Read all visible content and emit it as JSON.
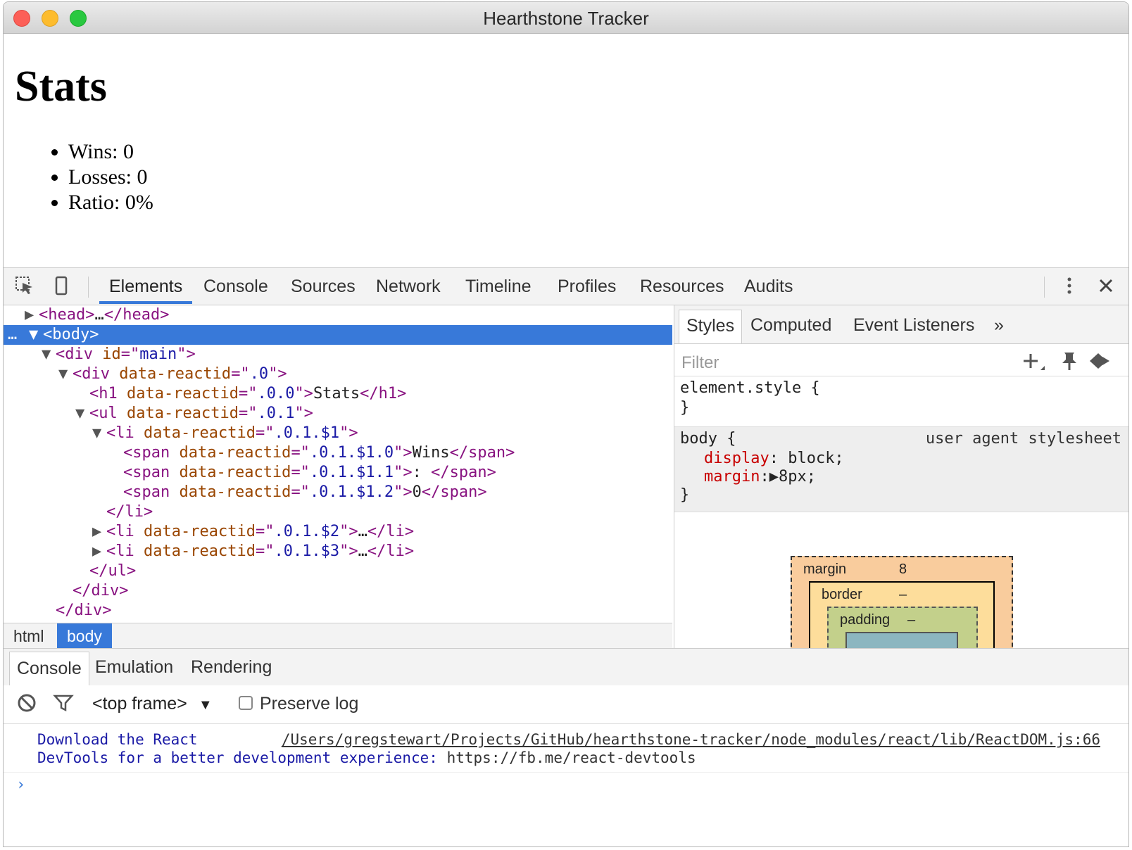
{
  "window": {
    "title": "Hearthstone Tracker"
  },
  "page": {
    "heading": "Stats",
    "items": [
      "Wins: 0",
      "Losses: 0",
      "Ratio: 0%"
    ]
  },
  "devtools": {
    "tabs": [
      "Elements",
      "Console",
      "Sources",
      "Network",
      "Timeline",
      "Profiles",
      "Resources",
      "Audits"
    ],
    "active_tab": "Elements",
    "dom": {
      "r0": {
        "open": "<head>",
        "ellipsis": "…",
        "close": "</head>"
      },
      "r1": {
        "dots": "…",
        "tag": "<body>"
      },
      "r2": {
        "tag_open": "<div",
        "attr": "id",
        "eq": "=\"",
        "val": "main",
        "end": "\">"
      },
      "r3": {
        "tag_open": "<div",
        "attr": "data-reactid",
        "eq": "=\"",
        "val": ".0",
        "end": "\">"
      },
      "r4": {
        "tag_open": "<h1",
        "attr": "data-reactid",
        "eq": "=\"",
        "val": ".0.0",
        "end": "\">",
        "text": "Stats",
        "close": "</h1>"
      },
      "r5": {
        "tag_open": "<ul",
        "attr": "data-reactid",
        "eq": "=\"",
        "val": ".0.1",
        "end": "\">"
      },
      "r6": {
        "tag_open": "<li",
        "attr": "data-reactid",
        "eq": "=\"",
        "val": ".0.1.$1",
        "end": "\">"
      },
      "r7": {
        "tag_open": "<span",
        "attr": "data-reactid",
        "eq": "=\"",
        "val": ".0.1.$1.0",
        "end": "\">",
        "text": "Wins",
        "close": "</span>"
      },
      "r8": {
        "tag_open": "<span",
        "attr": "data-reactid",
        "eq": "=\"",
        "val": ".0.1.$1.1",
        "end": "\">",
        "text": ": ",
        "close": "</span>"
      },
      "r9": {
        "tag_open": "<span",
        "attr": "data-reactid",
        "eq": "=\"",
        "val": ".0.1.$1.2",
        "end": "\">",
        "text": "0",
        "close": "</span>"
      },
      "r10": {
        "close": "</li>"
      },
      "r11": {
        "tag_open": "<li",
        "attr": "data-reactid",
        "eq": "=\"",
        "val": ".0.1.$2",
        "end": "\">",
        "ellipsis": "…",
        "close": "</li>"
      },
      "r12": {
        "tag_open": "<li",
        "attr": "data-reactid",
        "eq": "=\"",
        "val": ".0.1.$3",
        "end": "\">",
        "ellipsis": "…",
        "close": "</li>"
      },
      "r13": {
        "close": "</ul>"
      },
      "r14": {
        "close": "</div>"
      },
      "r15": {
        "close": "</div>"
      }
    },
    "breadcrumbs": [
      "html",
      "body"
    ],
    "styles": {
      "tabs": [
        "Styles",
        "Computed",
        "Event Listeners"
      ],
      "more": "»",
      "filter_placeholder": "Filter",
      "element_style_open": "element.style {",
      "element_style_close": "}",
      "body_selector": "body {",
      "body_source": "user agent stylesheet",
      "prop1_name": "display",
      "prop1_value": ": block;",
      "prop2_name": "margin",
      "prop2_value": ":▶8px;",
      "body_close": "}"
    },
    "box_model": {
      "margin_label": "margin",
      "margin_value": "8",
      "border_label": "border",
      "border_value": "–",
      "padding_label": "padding",
      "padding_value": "–"
    },
    "drawer": {
      "tabs": [
        "Console",
        "Emulation",
        "Rendering"
      ],
      "frame": "<top frame>",
      "preserve_log": "Preserve log",
      "message_line1": "Download the React",
      "message_line2": "DevTools for a better development experience:",
      "message_url": "https://fb.me/react-devtools",
      "source_link": "/Users/gregstewart/Projects/GitHub/hearthstone-tracker/node_modules/react/lib/ReactDOM.js:66",
      "prompt": "›"
    }
  }
}
